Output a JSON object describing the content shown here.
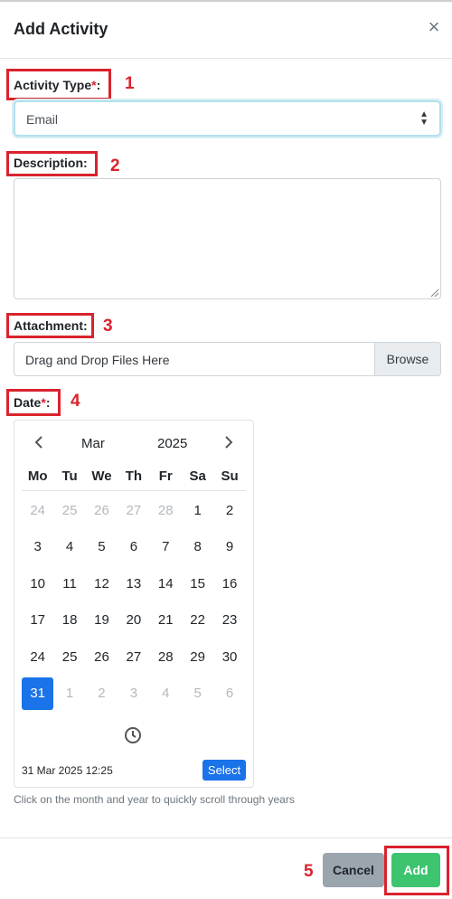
{
  "modal": {
    "title": "Add Activity",
    "close_symbol": "×"
  },
  "fields": {
    "activity_type": {
      "label": "Activity Type",
      "required_mark": "*",
      "colon": ":",
      "value": "Email"
    },
    "description": {
      "label": "Description:",
      "value": ""
    },
    "attachment": {
      "label": "Attachment:",
      "drop_text": "Drag and Drop Files Here",
      "browse_label": "Browse"
    },
    "date": {
      "label": "Date",
      "required_mark": "*",
      "colon": ":"
    }
  },
  "calendar": {
    "month": "Mar",
    "year": "2025",
    "prev_icon": "chevron-left-icon",
    "next_icon": "chevron-right-icon",
    "weekdays": [
      "Mo",
      "Tu",
      "We",
      "Th",
      "Fr",
      "Sa",
      "Su"
    ],
    "days": [
      {
        "d": "24",
        "muted": true
      },
      {
        "d": "25",
        "muted": true
      },
      {
        "d": "26",
        "muted": true
      },
      {
        "d": "27",
        "muted": true
      },
      {
        "d": "28",
        "muted": true
      },
      {
        "d": "1"
      },
      {
        "d": "2"
      },
      {
        "d": "3"
      },
      {
        "d": "4"
      },
      {
        "d": "5"
      },
      {
        "d": "6"
      },
      {
        "d": "7"
      },
      {
        "d": "8"
      },
      {
        "d": "9"
      },
      {
        "d": "10"
      },
      {
        "d": "11"
      },
      {
        "d": "12"
      },
      {
        "d": "13"
      },
      {
        "d": "14"
      },
      {
        "d": "15"
      },
      {
        "d": "16"
      },
      {
        "d": "17"
      },
      {
        "d": "18"
      },
      {
        "d": "19"
      },
      {
        "d": "20"
      },
      {
        "d": "21"
      },
      {
        "d": "22"
      },
      {
        "d": "23"
      },
      {
        "d": "24"
      },
      {
        "d": "25"
      },
      {
        "d": "26"
      },
      {
        "d": "27"
      },
      {
        "d": "28"
      },
      {
        "d": "29"
      },
      {
        "d": "30"
      },
      {
        "d": "31",
        "selected": true
      },
      {
        "d": "1",
        "muted": true
      },
      {
        "d": "2",
        "muted": true
      },
      {
        "d": "3",
        "muted": true
      },
      {
        "d": "4",
        "muted": true
      },
      {
        "d": "5",
        "muted": true
      },
      {
        "d": "6",
        "muted": true
      }
    ],
    "datetime": "31 Mar 2025 12:25",
    "select_label": "Select",
    "clock_icon": "clock-icon",
    "hint": "Click on the month and year to quickly scroll through years"
  },
  "footer": {
    "cancel_label": "Cancel",
    "add_label": "Add"
  },
  "annotations": [
    "1",
    "2",
    "3",
    "4",
    "5"
  ],
  "colors": {
    "selected_day": "#1a73e8",
    "add_button": "#3cc46e",
    "cancel_button": "#9aa5ae",
    "annotation": "#d9232d"
  }
}
